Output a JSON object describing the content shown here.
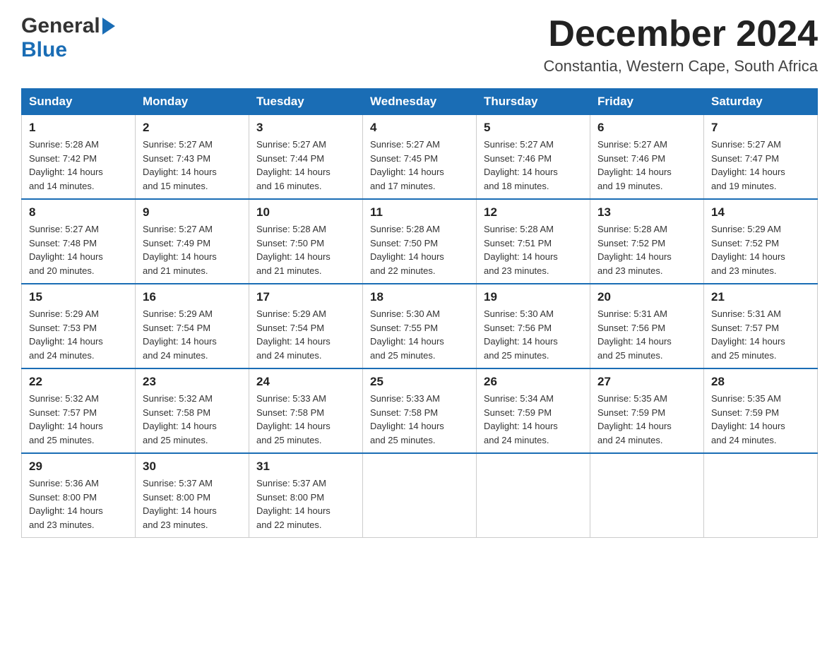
{
  "header": {
    "logo_general": "General",
    "logo_blue": "Blue",
    "month_title": "December 2024",
    "subtitle": "Constantia, Western Cape, South Africa"
  },
  "weekdays": [
    "Sunday",
    "Monday",
    "Tuesday",
    "Wednesday",
    "Thursday",
    "Friday",
    "Saturday"
  ],
  "weeks": [
    [
      {
        "day": "1",
        "sunrise": "5:28 AM",
        "sunset": "7:42 PM",
        "daylight": "14 hours and 14 minutes."
      },
      {
        "day": "2",
        "sunrise": "5:27 AM",
        "sunset": "7:43 PM",
        "daylight": "14 hours and 15 minutes."
      },
      {
        "day": "3",
        "sunrise": "5:27 AM",
        "sunset": "7:44 PM",
        "daylight": "14 hours and 16 minutes."
      },
      {
        "day": "4",
        "sunrise": "5:27 AM",
        "sunset": "7:45 PM",
        "daylight": "14 hours and 17 minutes."
      },
      {
        "day": "5",
        "sunrise": "5:27 AM",
        "sunset": "7:46 PM",
        "daylight": "14 hours and 18 minutes."
      },
      {
        "day": "6",
        "sunrise": "5:27 AM",
        "sunset": "7:46 PM",
        "daylight": "14 hours and 19 minutes."
      },
      {
        "day": "7",
        "sunrise": "5:27 AM",
        "sunset": "7:47 PM",
        "daylight": "14 hours and 19 minutes."
      }
    ],
    [
      {
        "day": "8",
        "sunrise": "5:27 AM",
        "sunset": "7:48 PM",
        "daylight": "14 hours and 20 minutes."
      },
      {
        "day": "9",
        "sunrise": "5:27 AM",
        "sunset": "7:49 PM",
        "daylight": "14 hours and 21 minutes."
      },
      {
        "day": "10",
        "sunrise": "5:28 AM",
        "sunset": "7:50 PM",
        "daylight": "14 hours and 21 minutes."
      },
      {
        "day": "11",
        "sunrise": "5:28 AM",
        "sunset": "7:50 PM",
        "daylight": "14 hours and 22 minutes."
      },
      {
        "day": "12",
        "sunrise": "5:28 AM",
        "sunset": "7:51 PM",
        "daylight": "14 hours and 23 minutes."
      },
      {
        "day": "13",
        "sunrise": "5:28 AM",
        "sunset": "7:52 PM",
        "daylight": "14 hours and 23 minutes."
      },
      {
        "day": "14",
        "sunrise": "5:29 AM",
        "sunset": "7:52 PM",
        "daylight": "14 hours and 23 minutes."
      }
    ],
    [
      {
        "day": "15",
        "sunrise": "5:29 AM",
        "sunset": "7:53 PM",
        "daylight": "14 hours and 24 minutes."
      },
      {
        "day": "16",
        "sunrise": "5:29 AM",
        "sunset": "7:54 PM",
        "daylight": "14 hours and 24 minutes."
      },
      {
        "day": "17",
        "sunrise": "5:29 AM",
        "sunset": "7:54 PM",
        "daylight": "14 hours and 24 minutes."
      },
      {
        "day": "18",
        "sunrise": "5:30 AM",
        "sunset": "7:55 PM",
        "daylight": "14 hours and 25 minutes."
      },
      {
        "day": "19",
        "sunrise": "5:30 AM",
        "sunset": "7:56 PM",
        "daylight": "14 hours and 25 minutes."
      },
      {
        "day": "20",
        "sunrise": "5:31 AM",
        "sunset": "7:56 PM",
        "daylight": "14 hours and 25 minutes."
      },
      {
        "day": "21",
        "sunrise": "5:31 AM",
        "sunset": "7:57 PM",
        "daylight": "14 hours and 25 minutes."
      }
    ],
    [
      {
        "day": "22",
        "sunrise": "5:32 AM",
        "sunset": "7:57 PM",
        "daylight": "14 hours and 25 minutes."
      },
      {
        "day": "23",
        "sunrise": "5:32 AM",
        "sunset": "7:58 PM",
        "daylight": "14 hours and 25 minutes."
      },
      {
        "day": "24",
        "sunrise": "5:33 AM",
        "sunset": "7:58 PM",
        "daylight": "14 hours and 25 minutes."
      },
      {
        "day": "25",
        "sunrise": "5:33 AM",
        "sunset": "7:58 PM",
        "daylight": "14 hours and 25 minutes."
      },
      {
        "day": "26",
        "sunrise": "5:34 AM",
        "sunset": "7:59 PM",
        "daylight": "14 hours and 24 minutes."
      },
      {
        "day": "27",
        "sunrise": "5:35 AM",
        "sunset": "7:59 PM",
        "daylight": "14 hours and 24 minutes."
      },
      {
        "day": "28",
        "sunrise": "5:35 AM",
        "sunset": "7:59 PM",
        "daylight": "14 hours and 24 minutes."
      }
    ],
    [
      {
        "day": "29",
        "sunrise": "5:36 AM",
        "sunset": "8:00 PM",
        "daylight": "14 hours and 23 minutes."
      },
      {
        "day": "30",
        "sunrise": "5:37 AM",
        "sunset": "8:00 PM",
        "daylight": "14 hours and 23 minutes."
      },
      {
        "day": "31",
        "sunrise": "5:37 AM",
        "sunset": "8:00 PM",
        "daylight": "14 hours and 22 minutes."
      },
      null,
      null,
      null,
      null
    ]
  ],
  "labels": {
    "sunrise": "Sunrise:",
    "sunset": "Sunset:",
    "daylight": "Daylight:"
  }
}
